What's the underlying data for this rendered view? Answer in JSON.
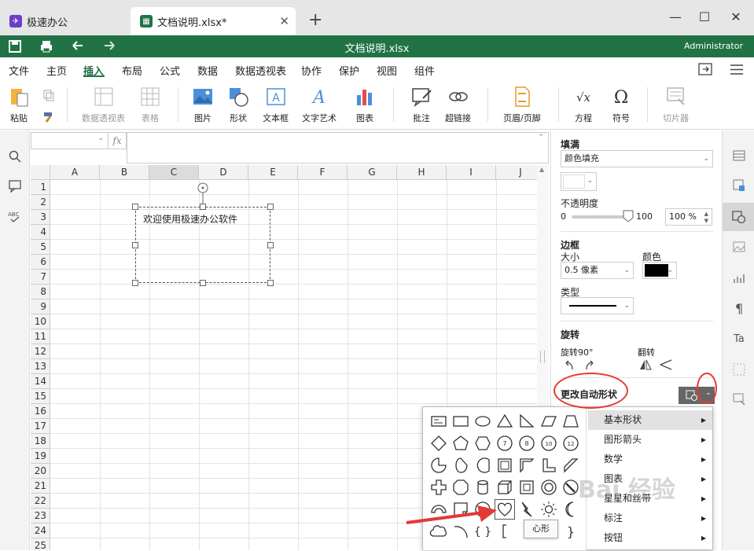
{
  "tabs": [
    {
      "label": "极速办公"
    },
    {
      "label": "文档说明.xlsx*"
    }
  ],
  "title": "文档说明.xlsx",
  "user": "Administrator",
  "menus": [
    "文件",
    "主页",
    "插入",
    "布局",
    "公式",
    "数据",
    "数据透视表",
    "协作",
    "保护",
    "视图",
    "组件"
  ],
  "ribbon": {
    "paste": "粘贴",
    "pivot": "数据透视表",
    "table": "表格",
    "image": "图片",
    "shape": "形状",
    "textbox": "文本框",
    "wordart": "文字艺术",
    "chart": "图表",
    "comment": "批注",
    "hyperlink": "超链接",
    "headerfooter": "页眉/页脚",
    "equation": "方程",
    "symbol": "符号",
    "slicer": "切片器"
  },
  "formula": {
    "fx": "fx"
  },
  "columns": [
    "A",
    "B",
    "C",
    "D",
    "E",
    "F",
    "G",
    "H",
    "I",
    "J"
  ],
  "rows": [
    "1",
    "2",
    "3",
    "4",
    "5",
    "6",
    "7",
    "8",
    "9",
    "10",
    "11",
    "12",
    "13",
    "14",
    "15",
    "16",
    "17",
    "18",
    "19",
    "20",
    "21",
    "22",
    "23",
    "24",
    "25"
  ],
  "textbox_text": "欢迎使用极速办公软件",
  "panel": {
    "fill_title": "填满",
    "fill_type": "颜色填充",
    "opacity_title": "不透明度",
    "opacity_min": "0",
    "opacity_max": "100",
    "opacity_value": "100 %",
    "opacity_level": 1.0,
    "border_title": "边框",
    "size_label": "大小",
    "color_label": "颜色",
    "size_value": "0.5 像素",
    "type_label": "类型",
    "rotate_title": "旋转",
    "rotate90_label": "旋转90°",
    "flip_label": "翻转",
    "change_shape": "更改自动形状"
  },
  "shape_menu": {
    "categories": [
      "基本形状",
      "图形箭头",
      "数学",
      "图表",
      "星星和丝带",
      "标注",
      "按钮"
    ],
    "tooltip": "心形"
  },
  "watermark": "Bai 经验",
  "colors": {
    "green": "#217346",
    "red": "#e53935"
  }
}
